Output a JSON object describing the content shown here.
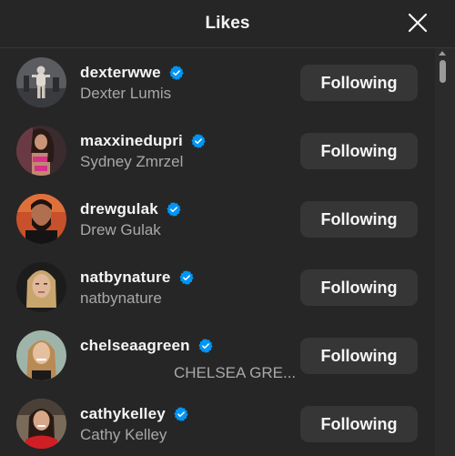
{
  "header": {
    "title": "Likes",
    "close_icon": "close-icon"
  },
  "users": [
    {
      "username": "dexterwwe",
      "full_name": "Dexter Lumis",
      "verified": true,
      "button_label": "Following"
    },
    {
      "username": "maxxinedupri",
      "full_name": "Sydney Zmrzel",
      "verified": true,
      "button_label": "Following"
    },
    {
      "username": "drewgulak",
      "full_name": "Drew Gulak",
      "verified": true,
      "button_label": "Following"
    },
    {
      "username": "natbynature",
      "full_name": "natbynature",
      "verified": true,
      "button_label": "Following"
    },
    {
      "username": "chelseaagreen",
      "full_name": "CHELSEA GRE...",
      "verified": true,
      "button_label": "Following"
    },
    {
      "username": "cathykelley",
      "full_name": "Cathy Kelley",
      "verified": true,
      "button_label": "Following"
    }
  ],
  "colors": {
    "background": "#262626",
    "button": "#363636",
    "verified_badge": "#0095f6",
    "secondary_text": "#a8a8a8"
  }
}
